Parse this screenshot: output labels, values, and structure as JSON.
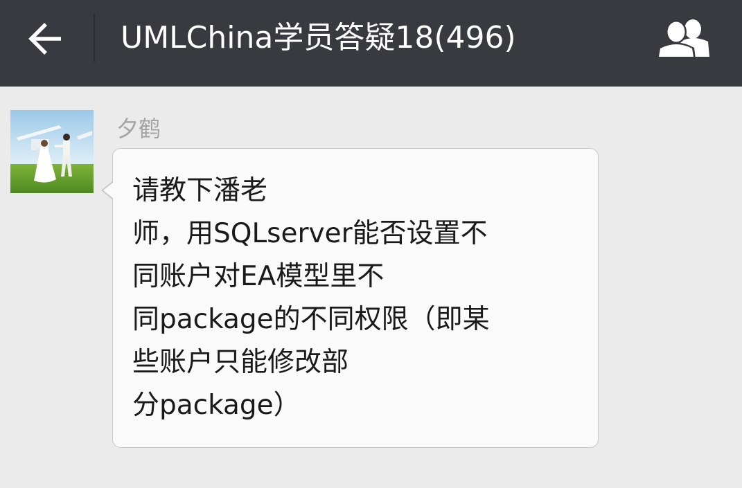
{
  "header": {
    "title": "UMLChina学员答疑18(496)",
    "back_icon": "arrow-left-icon",
    "members_icon": "group-members-icon"
  },
  "message": {
    "sender": "夕鹤",
    "avatar_icon": "wedding-photo-avatar",
    "lines": [
      "请教下潘老",
      "师，用SQLserver能否设置不",
      "同账户对EA模型里不",
      "同package的不同权限（即某",
      "些账户只能修改部",
      "分package）"
    ]
  },
  "colors": {
    "topbar": "#393a3f",
    "background": "#ebebeb",
    "bubble": "#fafafa",
    "sender_name": "#a3a3a3"
  }
}
